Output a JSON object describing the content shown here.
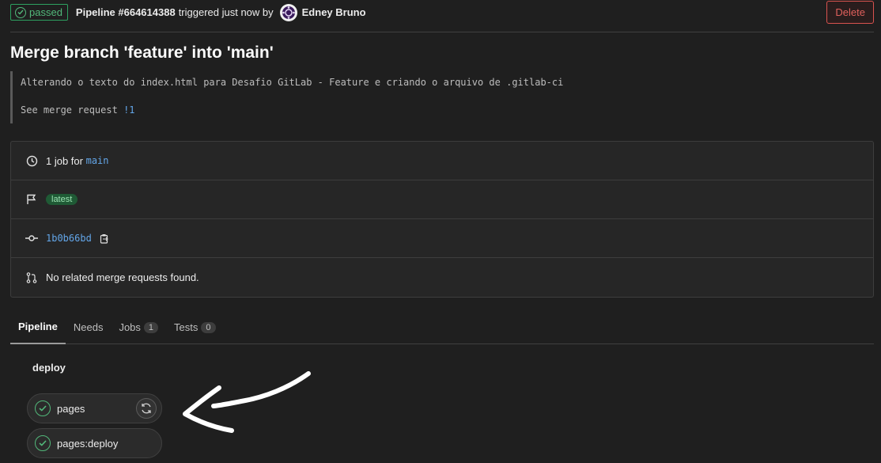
{
  "header": {
    "status": "passed",
    "pipeline_id": "Pipeline #664614388",
    "triggered_text": "triggered just now by",
    "user": "Edney Bruno",
    "delete_label": "Delete"
  },
  "commit": {
    "title": "Merge branch 'feature' into 'main'",
    "description_line1": "Alterando o texto do index.html para Desafio GitLab - Feature e criando o arquivo de .gitlab-ci",
    "see_mr_prefix": "See merge request",
    "mr_link": "!1"
  },
  "info": {
    "jobs_prefix": "1 job for",
    "branch": "main",
    "latest_badge": "latest",
    "sha": "1b0b66bd",
    "mr_status": "No related merge requests found."
  },
  "tabs": [
    {
      "label": "Pipeline"
    },
    {
      "label": "Needs"
    },
    {
      "label": "Jobs",
      "count": "1"
    },
    {
      "label": "Tests",
      "count": "0"
    }
  ],
  "stage": {
    "name": "deploy",
    "jobs": [
      {
        "name": "pages"
      },
      {
        "name": "pages:deploy"
      }
    ]
  },
  "colors": {
    "success": "#52b87a",
    "danger": "#d9534f",
    "link": "#63a6e9",
    "background": "#1f1f1f"
  },
  "icons": [
    "check-circle-icon",
    "clock-icon",
    "flag-icon",
    "commit-icon",
    "copy-icon",
    "merge-request-icon",
    "retry-icon",
    "arrow-annotation"
  ]
}
